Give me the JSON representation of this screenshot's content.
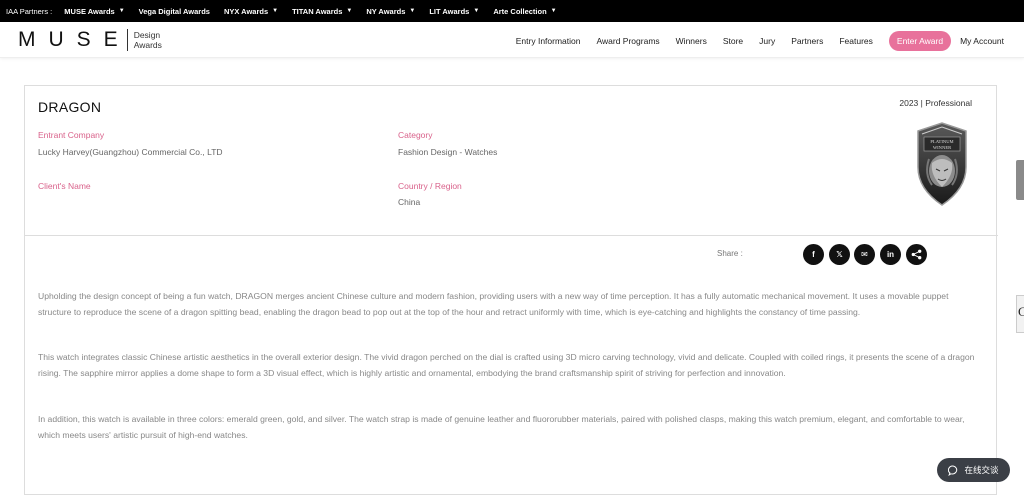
{
  "partner_bar": {
    "label": "IAA Partners :",
    "items": [
      "MUSE Awards",
      "Vega Digital Awards",
      "NYX Awards",
      "TITAN Awards",
      "NY Awards",
      "LIT Awards",
      "Arte Collection"
    ]
  },
  "header": {
    "logo": "MUSE",
    "logo_sub1": "Design",
    "logo_sub2": "Awards",
    "nav": [
      "Entry Information",
      "Award Programs",
      "Winners",
      "Store",
      "Jury",
      "Partners",
      "Features"
    ],
    "cta": "Enter Award",
    "account": "My Account",
    "cta_color": "#e8719b"
  },
  "entry": {
    "title": "DRAGON",
    "year_level": "2023 | Professional",
    "entrant_company_label": "Entrant Company",
    "entrant_company": "Lucky Harvey(Guangzhou) Commercial Co., LTD",
    "category_label": "Category",
    "category": "Fashion Design - Watches",
    "client_label": "Client's Name",
    "country_label": "Country / Region",
    "country": "China",
    "badge_line1": "PLATINUM",
    "badge_line2": "WINNER"
  },
  "share": {
    "label": "Share :",
    "buttons": [
      "f",
      "𝕏",
      "✉",
      "in",
      "share-icon"
    ]
  },
  "description": [
    "Upholding the design concept of being a fun watch, DRAGON merges ancient Chinese culture and modern fashion, providing users with a new way of time perception. It has a fully automatic mechanical movement. It uses a movable puppet structure to reproduce the scene of a dragon spitting bead, enabling the dragon bead to pop out at the top of the hour and retract uniformly with time, which is eye-catching and highlights the constancy of time passing.",
    "This watch integrates classic Chinese artistic aesthetics in the overall exterior design. The vivid dragon perched on the dial is crafted using 3D micro carving technology, vivid and delicate. Coupled with coiled rings, it presents the scene of a dragon rising. The sapphire mirror applies a dome shape to form a 3D visual effect, which is highly artistic and ornamental, embodying the brand craftsmanship spirit of striving for perfection and innovation.",
    "In addition, this watch is available in three colors: emerald green, gold, and silver. The watch strap is made of genuine leather and fluororubber materials, paired with polished clasps, making this watch premium, elegant, and comfortable to wear, which meets users' artistic pursuit of high-end watches."
  ],
  "edge": {
    "letter": "C"
  },
  "chat": {
    "label": "在线交谈"
  }
}
